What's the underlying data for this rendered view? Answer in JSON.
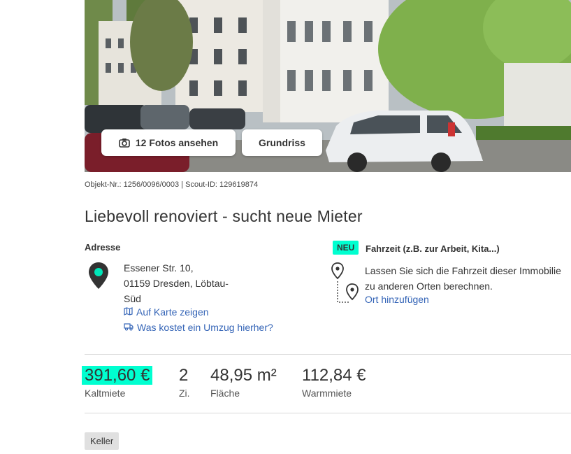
{
  "gallery": {
    "photos_button_label": "12 Fotos ansehen",
    "floorplan_button_label": "Grundriss"
  },
  "listing": {
    "ids": "Objekt-Nr.: 1256/0096/0003 | Scout-ID: 129619874",
    "title": "Liebevoll renoviert - sucht neue Mieter"
  },
  "address": {
    "heading": "Adresse",
    "street": "Essener Str. 10,",
    "city": "01159 Dresden, Löbtau-Süd",
    "map_link": "Auf Karte zeigen",
    "move_link": "Was kostet ein Umzug hierher?"
  },
  "travel": {
    "badge": "NEU",
    "heading": "Fahrzeit (z.B. zur Arbeit, Kita...)",
    "text": "Lassen Sie sich die Fahrzeit dieser Immobilie zu anderen Orten berechnen.",
    "link": "Ort hinzufügen"
  },
  "metrics": [
    {
      "value": "391,60 €",
      "label": "Kaltmiete"
    },
    {
      "value": "2",
      "label": "Zi."
    },
    {
      "value": "48,95 m²",
      "label": "Fläche"
    },
    {
      "value": "112,84 €",
      "label": "Warmmiete"
    }
  ],
  "tags": [
    "Keller"
  ],
  "colors": {
    "highlight": "#00ffd0",
    "link": "#3565b7",
    "pin": "#333333"
  },
  "icons": [
    "camera-icon",
    "map-pin-icon",
    "map-icon",
    "truck-icon",
    "route-pins-icon"
  ]
}
